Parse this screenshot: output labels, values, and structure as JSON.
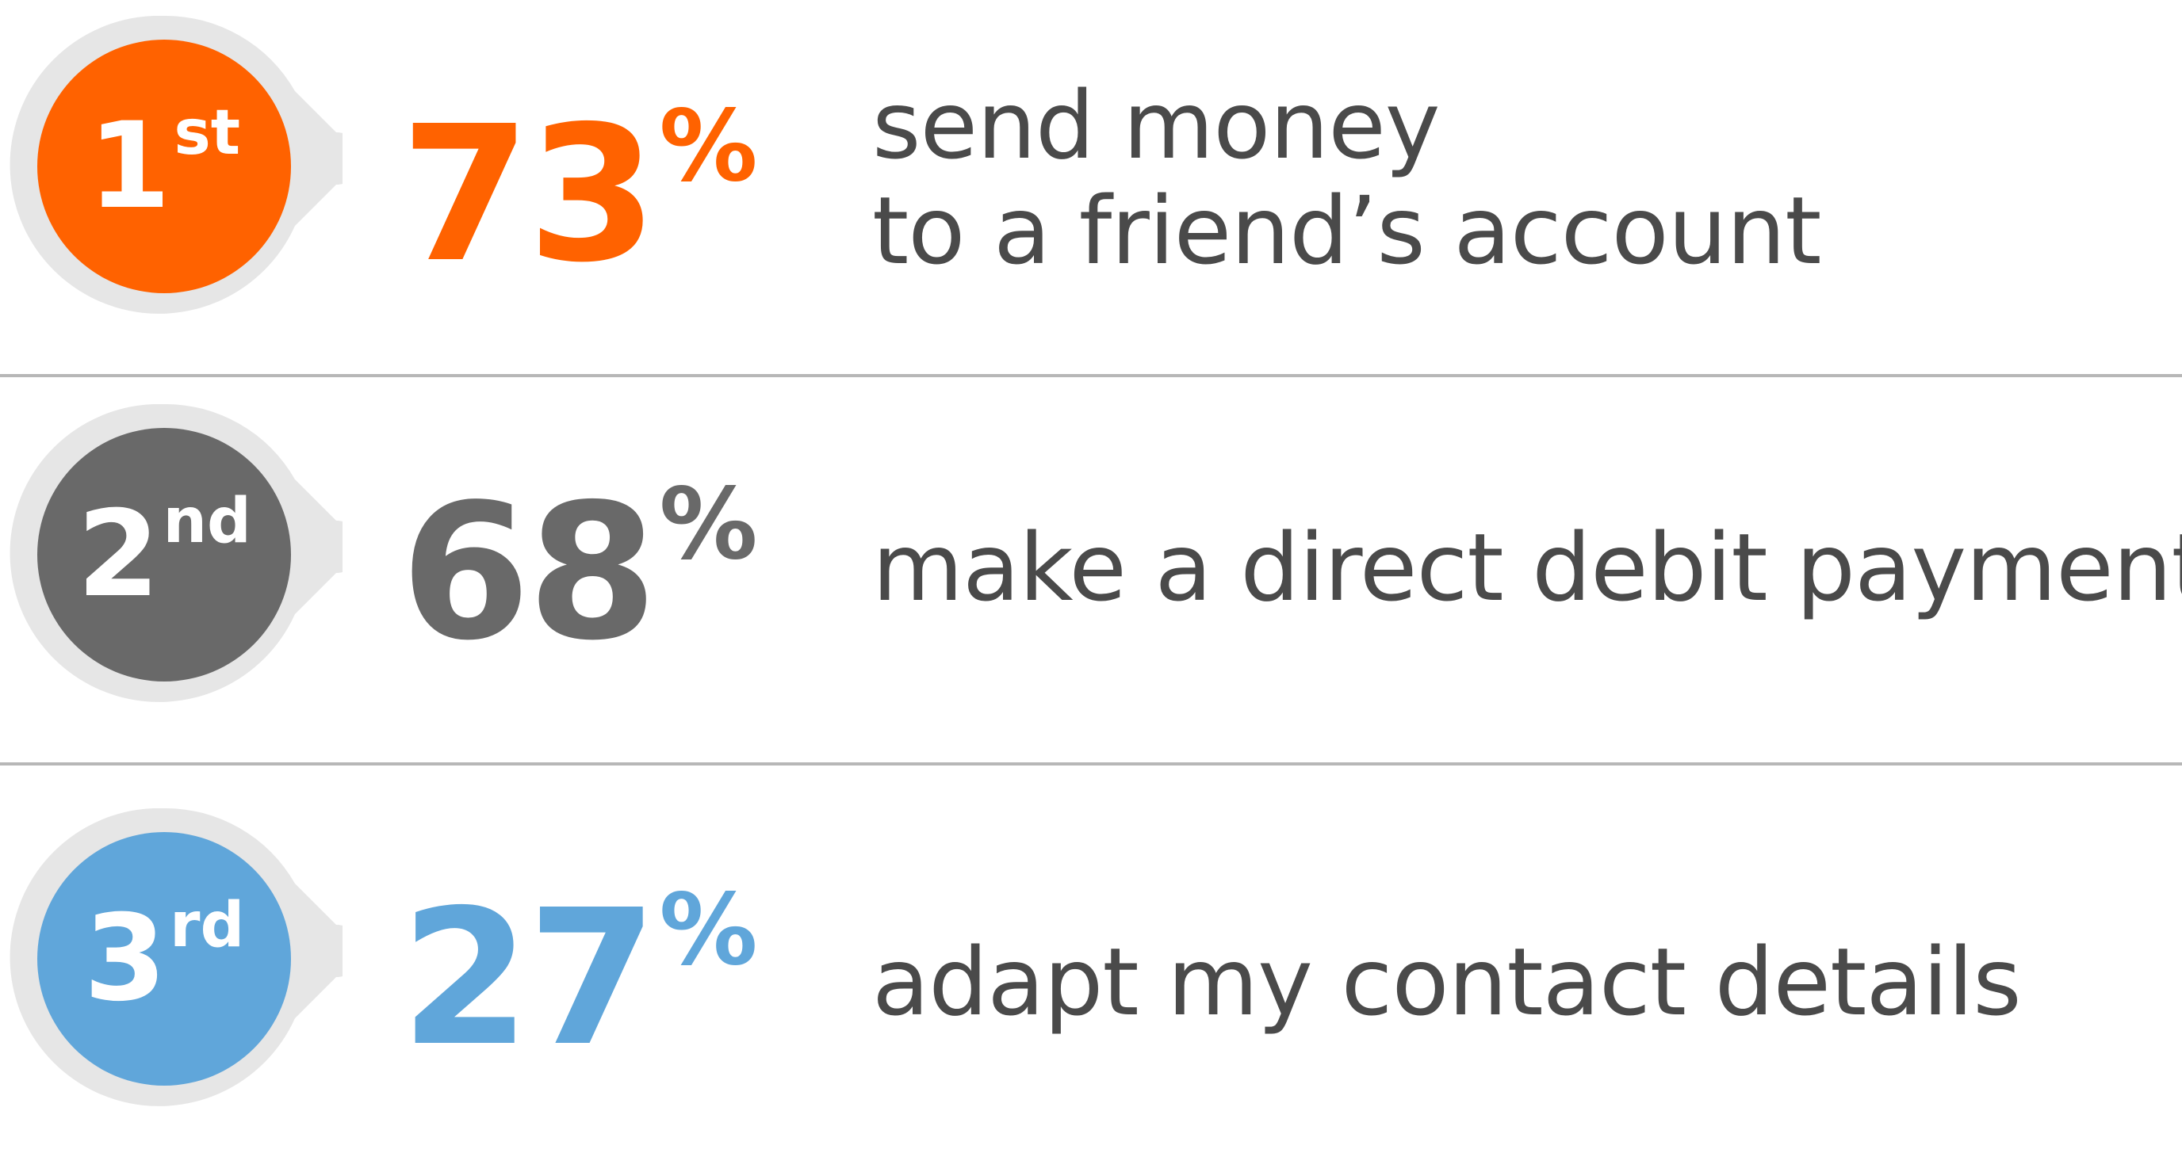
{
  "chart_data": {
    "type": "table",
    "rows": [
      {
        "rank": "1",
        "rank_suffix": "st",
        "percent_value": 73,
        "percent_text": "73",
        "percent_sign": "%",
        "description_lines": [
          "send money",
          "to a friend’s account"
        ],
        "color": "#ff6200"
      },
      {
        "rank": "2",
        "rank_suffix": "nd",
        "percent_value": 68,
        "percent_text": "68",
        "percent_sign": "%",
        "description_lines": [
          "make a direct debit payment"
        ],
        "color": "#696969"
      },
      {
        "rank": "3",
        "rank_suffix": "rd",
        "percent_value": 27,
        "percent_text": "27",
        "percent_sign": "%",
        "description_lines": [
          "adapt my contact details"
        ],
        "color": "#60a6da"
      }
    ]
  },
  "colors": {
    "badge_ring": "#e6e6e6",
    "divider": "#b7b7b7",
    "description_text": "#4a4a4a"
  }
}
